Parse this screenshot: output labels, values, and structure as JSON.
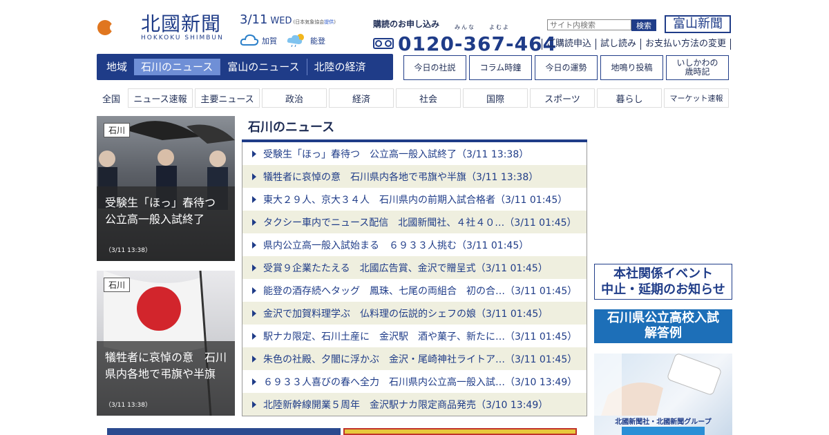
{
  "header": {
    "logo_jp": "北國新聞",
    "logo_en": "HOKKOKU SHIMBUN",
    "date": "3/11",
    "weekday": "WED",
    "weather_source_prefix": "(日本気象協会",
    "weather_source_link": "提供",
    "weather_source_suffix": ")",
    "weather": [
      {
        "area": "加賀",
        "icon": "cloud-icon"
      },
      {
        "area": "能登",
        "icon": "sun-rain-icon"
      }
    ],
    "subscribe_label": "購読のお申し込み",
    "phone_ruby": "みんな　　よむよ",
    "phone": "0120-367-464",
    "search_placeholder": "サイト内検索",
    "search_button": "検索",
    "toyama_logo": "富山新聞",
    "top_links": [
      "ご購読申込",
      "試し読み",
      "お支払い方法の変更"
    ]
  },
  "region_nav": {
    "label": "地域",
    "items": [
      "石川のニュース",
      "富山のニュース",
      "北陸の経済"
    ],
    "active_index": 0
  },
  "quick_links": [
    "今日の社説",
    "コラム時鐘",
    "今日の運勢",
    "地鳴り投稿",
    "いしかわの\n歳時記"
  ],
  "category_nav": [
    "全国",
    "ニュース速報",
    "主要ニュース",
    "政治",
    "経済",
    "社会",
    "国際",
    "スポーツ",
    "暮らし",
    "マーケット速報"
  ],
  "photos": [
    {
      "tag": "石川",
      "caption": "受験生「ほっ」春待つ　公立高一般入試終了",
      "time": "（3/11 13:38）"
    },
    {
      "tag": "石川",
      "caption": "犠牲者に哀悼の意　石川県内各地で弔旗や半旗",
      "time": "（3/11 13:38）"
    }
  ],
  "news": {
    "heading": "石川のニュース",
    "items": [
      "受験生「ほっ」春待つ　公立高一般入試終了（3/11 13:38）",
      "犠牲者に哀悼の意　石川県内各地で弔旗や半旗（3/11 13:38）",
      "東大２９人、京大３４人　石川県内の前期入試合格者（3/11 01:45）",
      "タクシー車内でニュース配信　北國新聞社、４社４０…（3/11 01:45）",
      "県内公立高一般入試始まる　６９３３人挑む（3/11 01:45）",
      "受賞９企業たたえる　北國広告賞、金沢で贈呈式（3/11 01:45）",
      "能登の酒存続へタッグ　鳳珠、七尾の両組合　初の合…（3/11 01:45）",
      "金沢で加賀料理学ぶ　仏料理の伝説的シェフの娘（3/11 01:45）",
      "駅ナカ限定、石川土産に　金沢駅　酒や菓子、新たに…（3/11 01:45）",
      "朱色の社殿、夕闇に浮かぶ　金沢・尾崎神社ライトア…（3/11 01:45）",
      "６９３３人喜びの春へ全力　石川県内公立高一般入試…（3/10 13:49）",
      "北陸新幹線開業５周年　金沢駅ナカ限定商品発売（3/10 13:49）"
    ]
  },
  "banners": {
    "event": [
      "本社関係イベント",
      "中止・延期のお知らせ"
    ],
    "exam": [
      "石川県公立高校入試",
      "解答例"
    ],
    "group": "北國新聞社・北國新聞グループ"
  },
  "colors": {
    "brand": "#1f3c88",
    "active_tab": "#6f8fd6",
    "row_alt": "#efefdf",
    "exam_banner": "#1d6fb8"
  }
}
